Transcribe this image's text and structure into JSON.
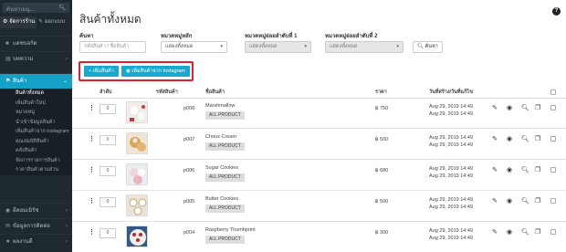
{
  "sidebar": {
    "search_placeholder": "ค้นหาเมนู...",
    "tabs": [
      {
        "label": "จัดการร้าน"
      },
      {
        "label": "ออกแบบ"
      }
    ],
    "items": [
      {
        "label": "แดชบอร์ด",
        "icon": "dashboard-icon"
      },
      {
        "label": "บทความ",
        "icon": "article-icon"
      },
      {
        "label": "สินค้า",
        "icon": "tag-icon"
      },
      {
        "label": "อีคอมเมิร์ซ",
        "icon": "cart-icon"
      },
      {
        "label": "ข้อมูลการติดต่อ",
        "icon": "contact-icon"
      },
      {
        "label": "ผลงานตี",
        "icon": "works-icon"
      }
    ],
    "submenu": [
      "สินค้าทั้งหมด",
      "เพิ่มสินค้าใหม่",
      "หมวดหมู่",
      "นำเข้าข้อมูลสินค้า",
      "เพิ่มสินค้าจาก Instagram",
      "คุณสมบัติสินค้า",
      "คลังสินค้า",
      "จัดการรายการสินค้า",
      "ราคาสินค้าตามส่วน"
    ]
  },
  "page": {
    "title": "สินค้าทั้งหมด",
    "help": "?"
  },
  "filters": {
    "search_label": "ค้นหา",
    "search_placeholder": "รหัสสินค้า / ชื่อสินค้า",
    "cat_label": "หมวดหมู่หลัก",
    "cat_value": "แสดงทั้งหมด",
    "sub1_label": "หมวดหมู่ย่อยลำดับที่ 1",
    "sub1_value": "แสดงทั้งหมด",
    "sub2_label": "หมวดหมู่ย่อยลำดับที่ 2",
    "sub2_value": "แสดงทั้งหมด",
    "search_button": "ค้นหา"
  },
  "actions": {
    "add_product": "+ เพิ่มสินค้า",
    "add_from_instagram": "เพิ่มสินค้าจาก Instagram"
  },
  "table": {
    "headers": {
      "order": "ลำดับ",
      "code": "รหัสสินค้า",
      "name": "ชื่อสินค้า",
      "price": "ราคา",
      "dates": "วันที่สร้าง/วันที่แก้ไข"
    },
    "rows": [
      {
        "order": "0",
        "code": "p008",
        "name": "Marshmallow",
        "category": "ALL PRODUCT",
        "price": "฿ 750",
        "created": "Aug 29, 2019 14:49",
        "updated": "Aug 29, 2019 14:49"
      },
      {
        "order": "0",
        "code": "p007",
        "name": "Choux Cream",
        "category": "ALL PRODUCT",
        "price": "฿ 500",
        "created": "Aug 29, 2019 14:49",
        "updated": "Aug 29, 2019 14:49"
      },
      {
        "order": "0",
        "code": "p006",
        "name": "Sugar Cookies",
        "category": "ALL PRODUCT",
        "price": "฿ 680",
        "created": "Aug 29, 2019 14:49",
        "updated": "Aug 29, 2019 14:49"
      },
      {
        "order": "0",
        "code": "p005",
        "name": "Butter Cookies",
        "category": "ALL PRODUCT",
        "price": "฿ 500",
        "created": "Aug 29, 2019 14:49",
        "updated": "Aug 29, 2019 14:49"
      },
      {
        "order": "0",
        "code": "p004",
        "name": "Raspberry Thumbprint",
        "category": "ALL PRODUCT",
        "price": "฿ 300",
        "created": "Aug 29, 2019 14:49",
        "updated": "Aug 29, 2019 14:49"
      }
    ]
  },
  "colors": {
    "accent": "#17a9cf",
    "sidebar_bg": "#1f2a30",
    "highlight_border": "#e0202a"
  }
}
